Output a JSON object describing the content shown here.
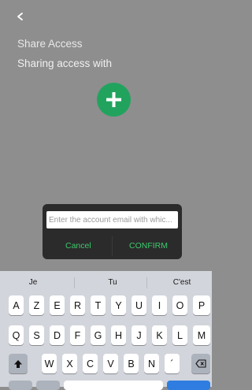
{
  "header": {
    "back_icon": "chevron-left-icon",
    "title": "Share Access",
    "subtitle": "Sharing access with"
  },
  "add_button": {
    "icon": "plus-icon",
    "color": "#21a35e"
  },
  "dialog": {
    "input_placeholder": "Enter the account email with whic...",
    "input_value": "",
    "cancel_label": "Cancel",
    "confirm_label": "CONFIRM",
    "accent_color": "#3ec96d"
  },
  "keyboard": {
    "suggestions": [
      "Je",
      "Tu",
      "C'est"
    ],
    "row1": [
      "A",
      "Z",
      "E",
      "R",
      "T",
      "Y",
      "U",
      "I",
      "O",
      "P"
    ],
    "row2": [
      "Q",
      "S",
      "D",
      "F",
      "G",
      "H",
      "J",
      "K",
      "L",
      "M"
    ],
    "row3": [
      "W",
      "X",
      "C",
      "V",
      "B",
      "N",
      "´"
    ],
    "shift_icon": "shift-arrow-icon",
    "backspace_icon": "backspace-icon"
  }
}
